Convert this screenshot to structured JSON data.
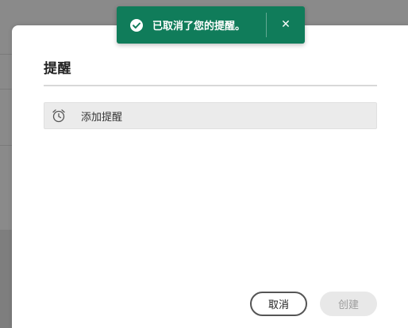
{
  "toast": {
    "message": "已取消了您的提醒。",
    "icon": "check-circle-icon",
    "close_glyph": "✕",
    "color": "#107c5a"
  },
  "dialog": {
    "title": "提醒",
    "add_reminder": {
      "label": "添加提醒",
      "icon": "alarm-clock-icon"
    },
    "buttons": {
      "cancel_label": "取消",
      "create_label": "创建"
    }
  }
}
